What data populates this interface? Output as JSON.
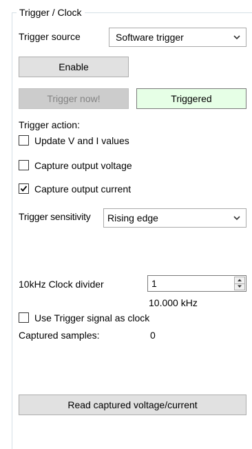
{
  "group": {
    "title": "Trigger / Clock"
  },
  "trigger_source": {
    "label": "Trigger source",
    "selected": "Software trigger"
  },
  "enable_button": {
    "label": "Enable"
  },
  "trigger_now_button": {
    "label": "Trigger now!"
  },
  "trigger_status": {
    "text": "Triggered",
    "background": "#e6ffe6"
  },
  "trigger_action": {
    "label": "Trigger action:",
    "options": [
      {
        "label": "Update V and I values",
        "checked": false
      },
      {
        "label": "Capture output voltage",
        "checked": false
      },
      {
        "label": "Capture output current",
        "checked": true
      }
    ]
  },
  "trigger_sensitivity": {
    "label": "Trigger sensitivity",
    "selected": "Rising edge"
  },
  "clock_divider": {
    "label": "10kHz Clock divider",
    "value": "1",
    "frequency": "10.000 kHz"
  },
  "use_trigger_clock": {
    "label": "Use Trigger signal as clock",
    "checked": false
  },
  "captured_samples": {
    "label": "Captured samples:",
    "value": "0"
  },
  "read_button": {
    "label": "Read captured voltage/current"
  },
  "colors": {
    "button_bg": "#e1e1e1",
    "disabled_text": "#838383",
    "groupbox_border": "#d5dfe5"
  },
  "icons": {
    "dropdown": "chevron-down-icon",
    "check": "checkmark-icon",
    "spin_up": "triangle-up-icon",
    "spin_down": "triangle-down-icon"
  }
}
